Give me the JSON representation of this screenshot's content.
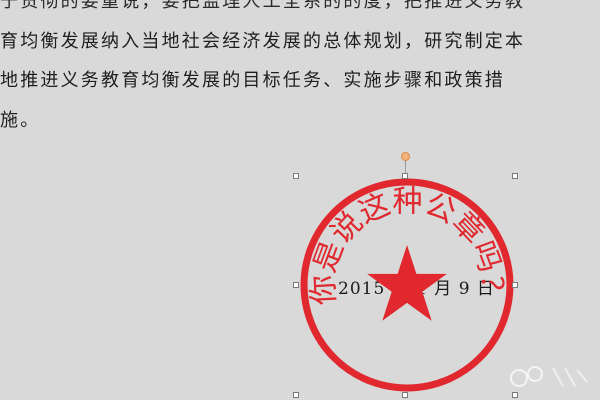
{
  "document": {
    "lines": [
      "于贯彻的要重说，要把监理人工全系的的度，把推进义务教",
      "育均衡发展纳入当地社会经济发展的总体规划，研究制定本",
      "地推进义务教育均衡发展的目标任务、实施步骤和政策措",
      "施。"
    ],
    "date_text": "2015 年 1 月 9 日"
  },
  "seal": {
    "arc_text": "你是说这种公章吗？",
    "color": "#e0282e",
    "handle_color": "#f2b47a"
  }
}
